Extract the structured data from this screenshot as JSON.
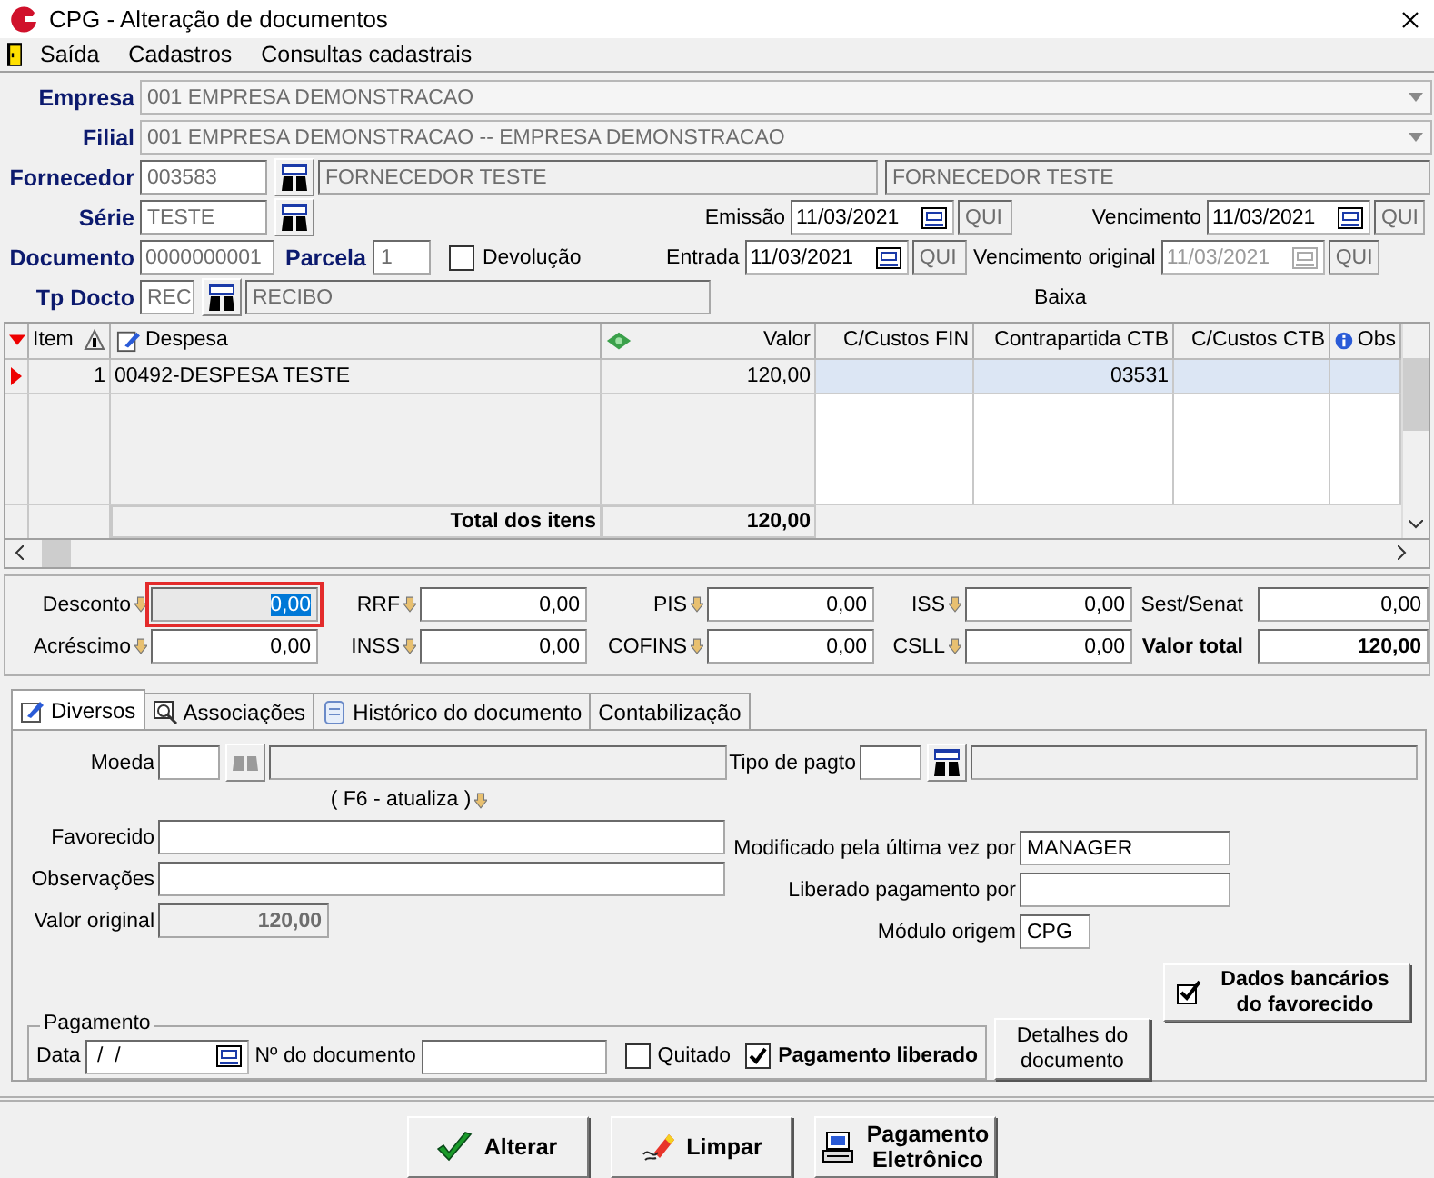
{
  "window": {
    "title": "CPG - Alteração de documentos"
  },
  "menu": [
    {
      "label": "Saída"
    },
    {
      "label": "Cadastros"
    },
    {
      "label": "Consultas cadastrais"
    }
  ],
  "header": {
    "empresa": {
      "label": "Empresa",
      "value": "001 EMPRESA DEMONSTRACAO"
    },
    "filial": {
      "label": "Filial",
      "value": "001 EMPRESA DEMONSTRACAO -- EMPRESA DEMONSTRACAO"
    },
    "fornecedor": {
      "label": "Fornecedor",
      "code": "003583",
      "name": "FORNECEDOR TESTE",
      "name_2": "FORNECEDOR TESTE"
    },
    "serie": {
      "label": "Série",
      "value": "TESTE"
    },
    "documento": {
      "label": "Documento",
      "value": "0000000001"
    },
    "parcela": {
      "label": "Parcela",
      "value": "1"
    },
    "devolucao": {
      "label": "Devolução",
      "checked": false
    },
    "tp_docto": {
      "label": "Tp Docto",
      "code": "REC",
      "name": "RECIBO"
    },
    "dates": [
      {
        "label": "Emissão",
        "value": "11/03/2021",
        "day": "QUI",
        "disabled": false
      },
      {
        "label": "Vencimento",
        "value": "11/03/2021",
        "day": "QUI",
        "disabled": false
      },
      {
        "label": "Entrada",
        "value": "11/03/2021",
        "day": "QUI",
        "disabled": false
      },
      {
        "label": "Vencimento original",
        "value": "11/03/2021",
        "day": "QUI",
        "disabled": true
      }
    ],
    "baixa": "Baixa"
  },
  "grid": {
    "columns": [
      "Item",
      "Despesa",
      "Valor",
      "C/Custos FIN",
      "Contrapartida CTB",
      "C/Custos CTB",
      "Obs"
    ],
    "rows": [
      {
        "item": "1",
        "despesa": "00492-DESPESA TESTE",
        "valor": "120,00",
        "contrapartida_ctb": "03531",
        "selected": true
      }
    ],
    "total_label": "Total dos itens",
    "total": "120,00"
  },
  "taxes": [
    {
      "label": "Desconto",
      "value": "0,00",
      "kind": "adjust",
      "focused": true
    },
    {
      "label": "RRF",
      "value": "0,00",
      "kind": "adjust",
      "focused": false
    },
    {
      "label": "PIS",
      "value": "0,00",
      "kind": "adjust",
      "focused": false
    },
    {
      "label": "ISS",
      "value": "0,00",
      "kind": "adjust",
      "focused": false
    },
    {
      "label": "Sest/Senat",
      "value": "0,00",
      "kind": "plain",
      "focused": false
    },
    {
      "label": "Acréscimo",
      "value": "0,00",
      "kind": "adjust",
      "focused": false
    },
    {
      "label": "INSS",
      "value": "0,00",
      "kind": "adjust",
      "focused": false
    },
    {
      "label": "COFINS",
      "value": "0,00",
      "kind": "adjust",
      "focused": false
    },
    {
      "label": "CSLL",
      "value": "0,00",
      "kind": "adjust",
      "focused": false
    },
    {
      "label": "Valor total",
      "value": "120,00",
      "kind": "total",
      "focused": false
    }
  ],
  "tabs": [
    {
      "label": "Diversos",
      "selected": true
    },
    {
      "label": "Associações",
      "selected": false
    },
    {
      "label": "Histórico do documento",
      "selected": false
    },
    {
      "label": "Contabilização",
      "selected": false
    }
  ],
  "diversos": {
    "moeda": {
      "label": "Moeda",
      "lookup_disabled": true
    },
    "tipo_pagto": {
      "label": "Tipo de pagto",
      "lookup_disabled": false
    },
    "f6_hint": "( F6 - atualiza )",
    "favorecido": {
      "label": "Favorecido"
    },
    "observacoes": {
      "label": "Observações"
    },
    "valor_original": {
      "label": "Valor original",
      "value": "120,00"
    },
    "modificado": {
      "label": "Modificado pela última vez por",
      "value": "MANAGER"
    },
    "liberado_por": {
      "label": "Liberado pagamento por"
    },
    "modulo": {
      "label": "Módulo origem",
      "value": "CPG"
    },
    "dados_bancarios": "Dados bancários do favorecido",
    "pagamento": {
      "title": "Pagamento",
      "data_label": "Data",
      "data_value": " /  /",
      "doc_label": "Nº do documento",
      "quitado": {
        "label": "Quitado",
        "checked": false
      },
      "liberado": {
        "label": "Pagamento liberado",
        "checked": true
      }
    },
    "detalhes": "Detalhes do documento"
  },
  "buttons": [
    {
      "label": "Alterar",
      "kind": "check"
    },
    {
      "label": "Limpar",
      "kind": "eraser"
    },
    {
      "label": "Pagamento Eletrônico",
      "kind": "computer"
    }
  ]
}
